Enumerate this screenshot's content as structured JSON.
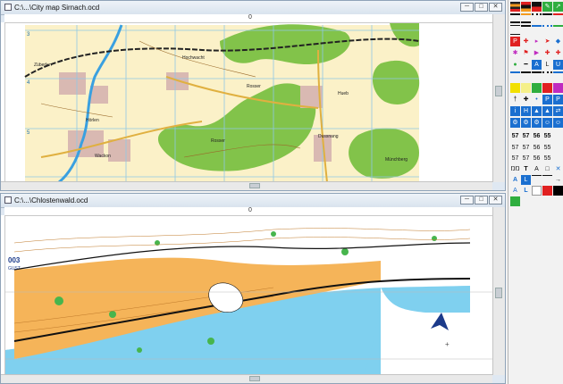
{
  "windows": [
    {
      "title": "C:\\...\\City map Sirnach.ocd",
      "ruler_zero": "0",
      "map_labels": {
        "zuzwil": "Züberlen",
        "hochwacht": "Hochwacht",
        "rosser": "Rosser",
        "hueb": "Hueb",
        "rosser2": "Rosser",
        "dussnang": "Dussnang",
        "hoerlen": "Hörlen",
        "wackon": "Wackon",
        "munchberg": "Münchberg"
      },
      "grid_numbers": [
        "3",
        "4",
        "5"
      ],
      "buttons": {
        "minimize": "─",
        "maximize": "□",
        "close": "✕"
      }
    },
    {
      "title": "C:\\...\\Chlostenwald.ocd",
      "ruler_zero": "0",
      "map_labels": {
        "logo_code": "003",
        "logo_sub": "GUST"
      },
      "buttons": {
        "minimize": "─",
        "maximize": "□",
        "close": "✕"
      }
    }
  ],
  "palette": {
    "colors": {
      "green": "#2fae3f",
      "yellow": "#f2e000",
      "blue": "#1a6fd0",
      "red": "#e02020",
      "black": "#000000",
      "magenta": "#c02ac0",
      "orange": "#f39a1e"
    },
    "rows": [
      [
        "line",
        "line",
        "line",
        "greenbtn",
        "greenbtn"
      ],
      [
        "line",
        "line",
        "line",
        "line",
        "line"
      ],
      [
        "line",
        "line",
        "line",
        "line",
        "line"
      ],
      [
        "line",
        "line",
        "line",
        "line",
        "line"
      ],
      [
        "P",
        "cross",
        "blank",
        "↔",
        "tri"
      ]
    ],
    "letters": {
      "P": "P",
      "T": "T",
      "A": "A",
      "L": "L",
      "S57": "57",
      "H": "H",
      "i": "i",
      "U": "U",
      "u": "u"
    },
    "text_row1": [
      "57",
      "57",
      "56",
      "55"
    ],
    "text_row2": [
      "57",
      "57",
      "56",
      "55"
    ],
    "text_row3": [
      "57",
      "57",
      "56",
      "55"
    ],
    "misc_row": [
      "ŊŊ",
      "T",
      "A",
      "□",
      "✕"
    ],
    "last_row": [
      "A",
      "L",
      "→"
    ]
  }
}
